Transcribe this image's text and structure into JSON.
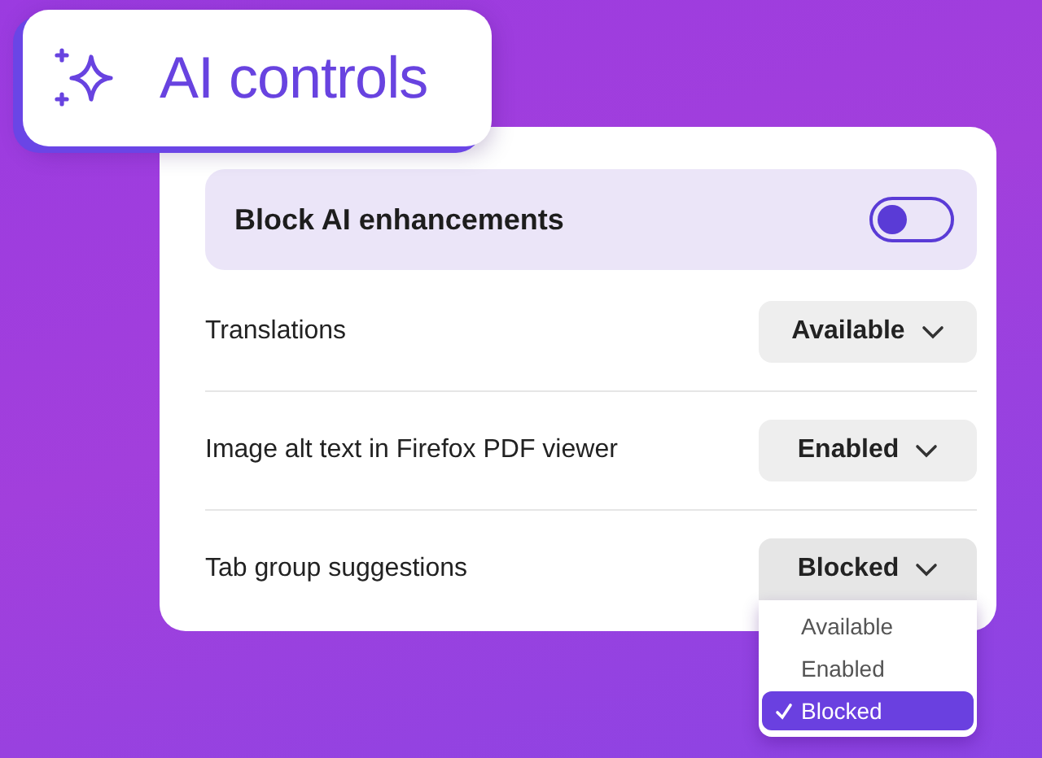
{
  "title": "AI controls",
  "block_all": {
    "label": "Block AI enhancements",
    "on": false
  },
  "features": [
    {
      "label": "Translations",
      "value": "Available",
      "expanded": false
    },
    {
      "label": "Image alt text in Firefox PDF viewer",
      "value": "Enabled",
      "expanded": false
    },
    {
      "label": "Tab group suggestions",
      "value": "Blocked",
      "expanded": true,
      "options": [
        {
          "label": "Available",
          "selected": false
        },
        {
          "label": "Enabled",
          "selected": false
        },
        {
          "label": "Blocked",
          "selected": true
        }
      ]
    }
  ]
}
